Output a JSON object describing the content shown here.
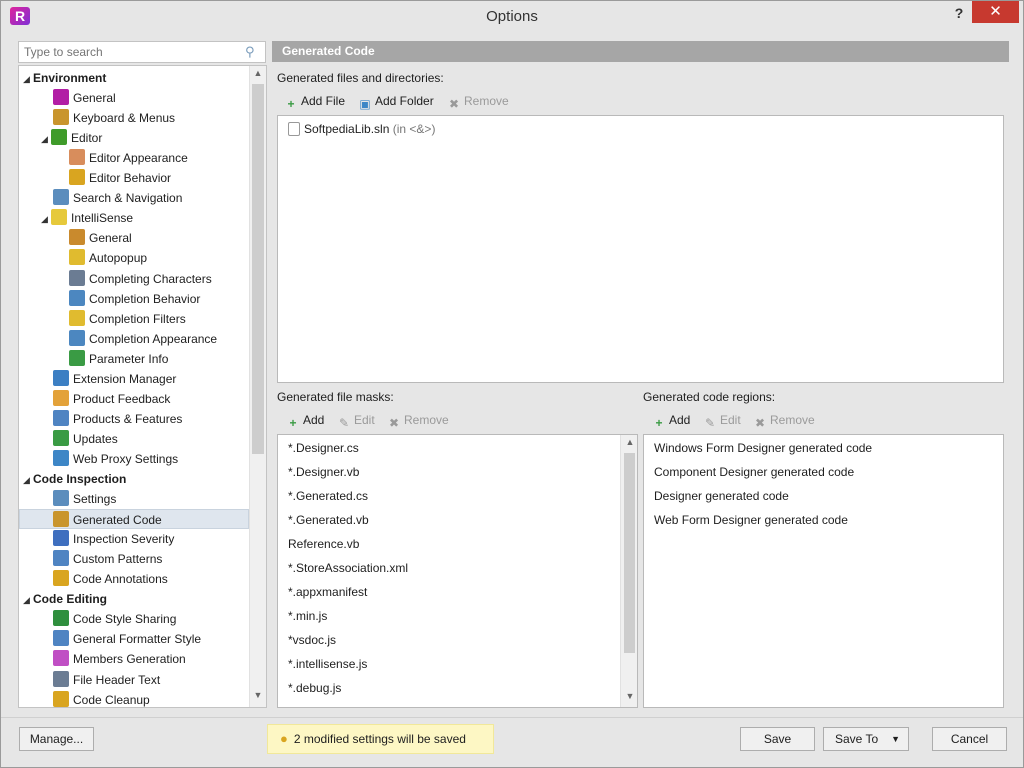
{
  "window": {
    "title": "Options",
    "help_label": "?",
    "close_label": "✕"
  },
  "search": {
    "placeholder": "Type to search"
  },
  "tree": [
    {
      "label": "Environment",
      "level": 0,
      "category": true,
      "expanded": true,
      "icon": "",
      "color": ""
    },
    {
      "label": "General",
      "level": 1,
      "icon": "resharper-icon",
      "color": "#b21ea5"
    },
    {
      "label": "Keyboard & Menus",
      "level": 1,
      "icon": "keyboard-icon",
      "color": "#c9952d"
    },
    {
      "label": "Editor",
      "level": 1,
      "expandable": true,
      "expanded": true,
      "icon": "pencil-icon",
      "color": "#3f9b2a"
    },
    {
      "label": "Editor Appearance",
      "level": 2,
      "icon": "palette-icon",
      "color": "#d88d5c"
    },
    {
      "label": "Editor Behavior",
      "level": 2,
      "icon": "gear-icon",
      "color": "#d9a520"
    },
    {
      "label": "Search & Navigation",
      "level": 1,
      "icon": "magnifier-icon",
      "color": "#5b8dbd"
    },
    {
      "label": "IntelliSense",
      "level": 1,
      "expandable": true,
      "expanded": true,
      "icon": "bulb-icon",
      "color": "#e6c93b"
    },
    {
      "label": "General",
      "level": 2,
      "icon": "intellisense-general-icon",
      "color": "#c98a2d"
    },
    {
      "label": "Autopopup",
      "level": 2,
      "icon": "autopopup-icon",
      "color": "#e0bb2f"
    },
    {
      "label": "Completing Characters",
      "level": 2,
      "icon": "font-icon",
      "color": "#6b7c93"
    },
    {
      "label": "Completion Behavior",
      "level": 2,
      "icon": "completion-behavior-icon",
      "color": "#4c87c0"
    },
    {
      "label": "Completion Filters",
      "level": 2,
      "icon": "filter-icon",
      "color": "#e0bb2f"
    },
    {
      "label": "Completion Appearance",
      "level": 2,
      "icon": "completion-appearance-icon",
      "color": "#4c87c0"
    },
    {
      "label": "Parameter Info",
      "level": 2,
      "icon": "parameter-info-icon",
      "color": "#3a9b44"
    },
    {
      "label": "Extension Manager",
      "level": 1,
      "icon": "extension-icon",
      "color": "#3c7fc3"
    },
    {
      "label": "Product Feedback",
      "level": 1,
      "icon": "envelope-icon",
      "color": "#e3a23a"
    },
    {
      "label": "Products & Features",
      "level": 1,
      "icon": "products-icon",
      "color": "#4f84c2"
    },
    {
      "label": "Updates",
      "level": 1,
      "icon": "updates-icon",
      "color": "#3a9b44"
    },
    {
      "label": "Web Proxy Settings",
      "level": 1,
      "icon": "globe-icon",
      "color": "#3d86c6"
    },
    {
      "label": "Code Inspection",
      "level": 0,
      "category": true,
      "expanded": true,
      "icon": "",
      "color": ""
    },
    {
      "label": "Settings",
      "level": 1,
      "icon": "settings-icon",
      "color": "#5b8dbd"
    },
    {
      "label": "Generated Code",
      "level": 1,
      "selected": true,
      "icon": "generated-code-icon",
      "color": "#c9952d"
    },
    {
      "label": "Inspection Severity",
      "level": 1,
      "icon": "severity-icon",
      "color": "#3f6fbf"
    },
    {
      "label": "Custom Patterns",
      "level": 1,
      "icon": "custom-patterns-icon",
      "color": "#4f84c2"
    },
    {
      "label": "Code Annotations",
      "level": 1,
      "icon": "annotations-icon",
      "color": "#d9a520"
    },
    {
      "label": "Code Editing",
      "level": 0,
      "category": true,
      "expanded": true,
      "icon": "",
      "color": ""
    },
    {
      "label": "Code Style Sharing",
      "level": 1,
      "icon": "style-sharing-icon",
      "color": "#2f8f3e"
    },
    {
      "label": "General Formatter Style",
      "level": 1,
      "icon": "formatter-icon",
      "color": "#4f84c2"
    },
    {
      "label": "Members Generation",
      "level": 1,
      "icon": "members-icon",
      "color": "#c04fc4"
    },
    {
      "label": "File Header Text",
      "level": 1,
      "icon": "file-header-icon",
      "color": "#6b7c93"
    },
    {
      "label": "Code Cleanup",
      "level": 1,
      "icon": "broom-icon",
      "color": "#d9a520"
    }
  ],
  "page": {
    "header": "Generated Code",
    "files_label": "Generated files and directories:",
    "files_toolbar": {
      "add_file": "Add File",
      "add_folder": "Add Folder",
      "remove": "Remove"
    },
    "files": [
      {
        "name": "SoftpediaLib.sln",
        "note": "(in <&>)"
      }
    ],
    "masks_label": "Generated file masks:",
    "masks_toolbar": {
      "add": "Add",
      "edit": "Edit",
      "remove": "Remove"
    },
    "masks": [
      "*.Designer.cs",
      "*.Designer.vb",
      "*.Generated.cs",
      "*.Generated.vb",
      "Reference.vb",
      "*.StoreAssociation.xml",
      "*.appxmanifest",
      "*.min.js",
      "*vsdoc.js",
      "*.intellisense.js",
      "*.debug.js"
    ],
    "regions_label": "Generated code regions:",
    "regions_toolbar": {
      "add": "Add",
      "edit": "Edit",
      "remove": "Remove"
    },
    "regions": [
      "Windows Form Designer generated code",
      "Component Designer generated code",
      "Designer generated code",
      "Web Form Designer generated code"
    ]
  },
  "footer": {
    "manage": "Manage...",
    "notice": "2  modified settings will be saved",
    "save": "Save",
    "save_to": "Save To",
    "cancel": "Cancel"
  },
  "colors": {
    "accent": "#a6a6a6",
    "close": "#c7392f",
    "selection": "#dfe6ee",
    "notice_bg": "#fdf7c4"
  }
}
